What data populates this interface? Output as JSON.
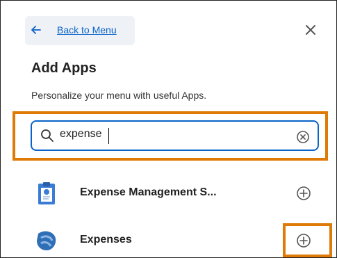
{
  "nav": {
    "back_label": "Back to Menu"
  },
  "header": {
    "title": "Add Apps",
    "subtitle": "Personalize your menu with useful Apps."
  },
  "search": {
    "value": "expense"
  },
  "results": [
    {
      "label": "Expense Management S...",
      "icon": "clipboard-app-icon"
    },
    {
      "label": "Expenses",
      "icon": "expenses-app-icon"
    }
  ],
  "icons": {
    "back": "arrow-left-icon",
    "close": "close-icon",
    "search": "search-icon",
    "clear": "clear-circle-x-icon",
    "add": "add-circle-plus-icon"
  },
  "colors": {
    "accent": "#0b63c9",
    "highlight": "#e07a06",
    "back_bg": "#eef1f5"
  }
}
